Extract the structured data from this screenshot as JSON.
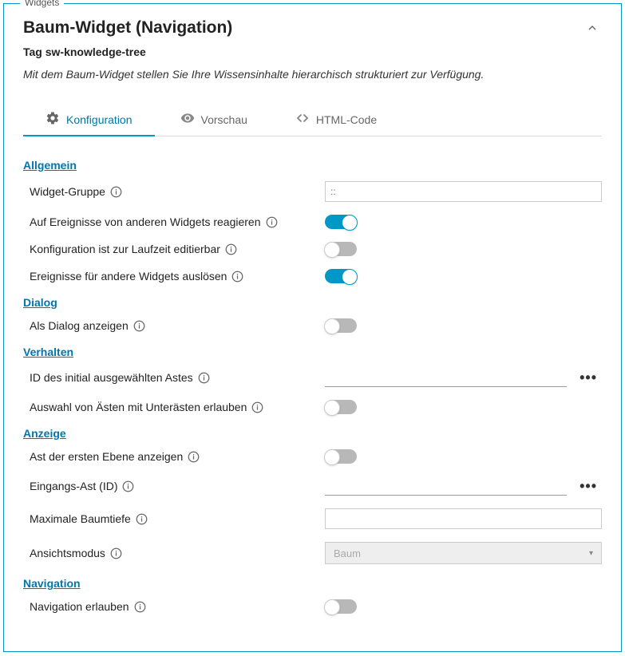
{
  "legend": "Widgets",
  "header": {
    "title": "Baum-Widget (Navigation)",
    "subtitle": "Tag sw-knowledge-tree",
    "description": "Mit dem Baum-Widget stellen Sie Ihre Wissensinhalte hierarchisch strukturiert zur Verfügung."
  },
  "tabs": {
    "config": "Konfiguration",
    "preview": "Vorschau",
    "html": "HTML-Code"
  },
  "sections": {
    "allgemein": {
      "title": "Allgemein",
      "fields": {
        "widget_gruppe": {
          "label": "Widget-Gruppe",
          "placeholder": "::"
        },
        "auf_ereignisse": {
          "label": "Auf Ereignisse von anderen Widgets reagieren",
          "value": true
        },
        "konfig_laufzeit": {
          "label": "Konfiguration ist zur Laufzeit editierbar",
          "value": false
        },
        "ereignisse_ausloesen": {
          "label": "Ereignisse für andere Widgets auslösen",
          "value": true
        }
      }
    },
    "dialog": {
      "title": "Dialog",
      "fields": {
        "als_dialog": {
          "label": "Als Dialog anzeigen",
          "value": false
        }
      }
    },
    "verhalten": {
      "title": "Verhalten",
      "fields": {
        "id_initial": {
          "label": "ID des initial ausgewählten Astes",
          "value": ""
        },
        "auswahl_aeste": {
          "label": "Auswahl von Ästen mit Unterästen erlauben",
          "value": false
        }
      }
    },
    "anzeige": {
      "title": "Anzeige",
      "fields": {
        "ast_erste_ebene": {
          "label": "Ast der ersten Ebene anzeigen",
          "value": false
        },
        "eingangs_ast": {
          "label": "Eingangs-Ast (ID)",
          "value": ""
        },
        "max_baumtiefe": {
          "label": "Maximale Baumtiefe",
          "value": ""
        },
        "ansichtsmodus": {
          "label": "Ansichtsmodus",
          "selected": "Baum"
        }
      }
    },
    "navigation": {
      "title": "Navigation",
      "fields": {
        "nav_erlauben": {
          "label": "Navigation erlauben",
          "value": false
        }
      }
    }
  }
}
